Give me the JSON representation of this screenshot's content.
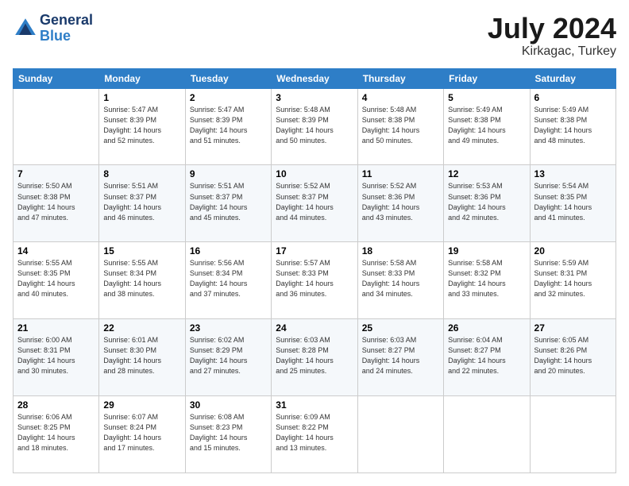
{
  "header": {
    "logo_line1": "General",
    "logo_line2": "Blue",
    "month_year": "July 2024",
    "location": "Kirkagac, Turkey"
  },
  "days_of_week": [
    "Sunday",
    "Monday",
    "Tuesday",
    "Wednesday",
    "Thursday",
    "Friday",
    "Saturday"
  ],
  "weeks": [
    [
      {
        "day": "",
        "info": ""
      },
      {
        "day": "1",
        "info": "Sunrise: 5:47 AM\nSunset: 8:39 PM\nDaylight: 14 hours\nand 52 minutes."
      },
      {
        "day": "2",
        "info": "Sunrise: 5:47 AM\nSunset: 8:39 PM\nDaylight: 14 hours\nand 51 minutes."
      },
      {
        "day": "3",
        "info": "Sunrise: 5:48 AM\nSunset: 8:39 PM\nDaylight: 14 hours\nand 50 minutes."
      },
      {
        "day": "4",
        "info": "Sunrise: 5:48 AM\nSunset: 8:38 PM\nDaylight: 14 hours\nand 50 minutes."
      },
      {
        "day": "5",
        "info": "Sunrise: 5:49 AM\nSunset: 8:38 PM\nDaylight: 14 hours\nand 49 minutes."
      },
      {
        "day": "6",
        "info": "Sunrise: 5:49 AM\nSunset: 8:38 PM\nDaylight: 14 hours\nand 48 minutes."
      }
    ],
    [
      {
        "day": "7",
        "info": "Sunrise: 5:50 AM\nSunset: 8:38 PM\nDaylight: 14 hours\nand 47 minutes."
      },
      {
        "day": "8",
        "info": "Sunrise: 5:51 AM\nSunset: 8:37 PM\nDaylight: 14 hours\nand 46 minutes."
      },
      {
        "day": "9",
        "info": "Sunrise: 5:51 AM\nSunset: 8:37 PM\nDaylight: 14 hours\nand 45 minutes."
      },
      {
        "day": "10",
        "info": "Sunrise: 5:52 AM\nSunset: 8:37 PM\nDaylight: 14 hours\nand 44 minutes."
      },
      {
        "day": "11",
        "info": "Sunrise: 5:52 AM\nSunset: 8:36 PM\nDaylight: 14 hours\nand 43 minutes."
      },
      {
        "day": "12",
        "info": "Sunrise: 5:53 AM\nSunset: 8:36 PM\nDaylight: 14 hours\nand 42 minutes."
      },
      {
        "day": "13",
        "info": "Sunrise: 5:54 AM\nSunset: 8:35 PM\nDaylight: 14 hours\nand 41 minutes."
      }
    ],
    [
      {
        "day": "14",
        "info": "Sunrise: 5:55 AM\nSunset: 8:35 PM\nDaylight: 14 hours\nand 40 minutes."
      },
      {
        "day": "15",
        "info": "Sunrise: 5:55 AM\nSunset: 8:34 PM\nDaylight: 14 hours\nand 38 minutes."
      },
      {
        "day": "16",
        "info": "Sunrise: 5:56 AM\nSunset: 8:34 PM\nDaylight: 14 hours\nand 37 minutes."
      },
      {
        "day": "17",
        "info": "Sunrise: 5:57 AM\nSunset: 8:33 PM\nDaylight: 14 hours\nand 36 minutes."
      },
      {
        "day": "18",
        "info": "Sunrise: 5:58 AM\nSunset: 8:33 PM\nDaylight: 14 hours\nand 34 minutes."
      },
      {
        "day": "19",
        "info": "Sunrise: 5:58 AM\nSunset: 8:32 PM\nDaylight: 14 hours\nand 33 minutes."
      },
      {
        "day": "20",
        "info": "Sunrise: 5:59 AM\nSunset: 8:31 PM\nDaylight: 14 hours\nand 32 minutes."
      }
    ],
    [
      {
        "day": "21",
        "info": "Sunrise: 6:00 AM\nSunset: 8:31 PM\nDaylight: 14 hours\nand 30 minutes."
      },
      {
        "day": "22",
        "info": "Sunrise: 6:01 AM\nSunset: 8:30 PM\nDaylight: 14 hours\nand 28 minutes."
      },
      {
        "day": "23",
        "info": "Sunrise: 6:02 AM\nSunset: 8:29 PM\nDaylight: 14 hours\nand 27 minutes."
      },
      {
        "day": "24",
        "info": "Sunrise: 6:03 AM\nSunset: 8:28 PM\nDaylight: 14 hours\nand 25 minutes."
      },
      {
        "day": "25",
        "info": "Sunrise: 6:03 AM\nSunset: 8:27 PM\nDaylight: 14 hours\nand 24 minutes."
      },
      {
        "day": "26",
        "info": "Sunrise: 6:04 AM\nSunset: 8:27 PM\nDaylight: 14 hours\nand 22 minutes."
      },
      {
        "day": "27",
        "info": "Sunrise: 6:05 AM\nSunset: 8:26 PM\nDaylight: 14 hours\nand 20 minutes."
      }
    ],
    [
      {
        "day": "28",
        "info": "Sunrise: 6:06 AM\nSunset: 8:25 PM\nDaylight: 14 hours\nand 18 minutes."
      },
      {
        "day": "29",
        "info": "Sunrise: 6:07 AM\nSunset: 8:24 PM\nDaylight: 14 hours\nand 17 minutes."
      },
      {
        "day": "30",
        "info": "Sunrise: 6:08 AM\nSunset: 8:23 PM\nDaylight: 14 hours\nand 15 minutes."
      },
      {
        "day": "31",
        "info": "Sunrise: 6:09 AM\nSunset: 8:22 PM\nDaylight: 14 hours\nand 13 minutes."
      },
      {
        "day": "",
        "info": ""
      },
      {
        "day": "",
        "info": ""
      },
      {
        "day": "",
        "info": ""
      }
    ]
  ]
}
